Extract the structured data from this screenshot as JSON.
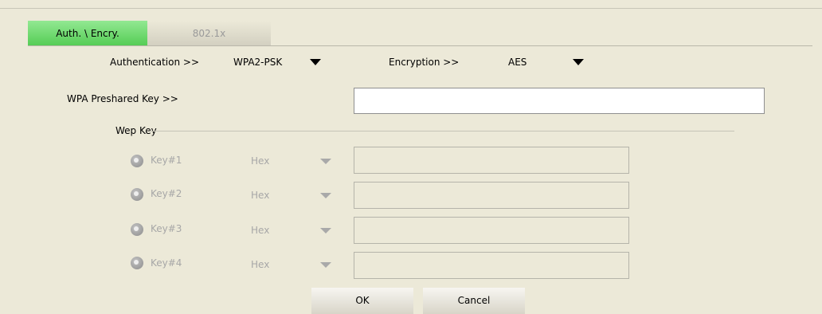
{
  "tabs": [
    {
      "label": "Auth. \\ Encry.",
      "active": true
    },
    {
      "label": "802.1x",
      "active": false
    }
  ],
  "authentication": {
    "label": "Authentication >>",
    "value": "WPA2-PSK"
  },
  "encryption": {
    "label": "Encryption >>",
    "value": "AES"
  },
  "wpa_preshared_key": {
    "label": "WPA Preshared Key >>",
    "value": ""
  },
  "wep_key": {
    "group_label": "Wep Key",
    "keys": [
      {
        "label": "Key#1",
        "format": "Hex",
        "value": ""
      },
      {
        "label": "Key#2",
        "format": "Hex",
        "value": ""
      },
      {
        "label": "Key#3",
        "format": "Hex",
        "value": ""
      },
      {
        "label": "Key#4",
        "format": "Hex",
        "value": ""
      }
    ]
  },
  "buttons": {
    "ok": "OK",
    "cancel": "Cancel"
  },
  "colors": {
    "background": "#ece9d8",
    "active_tab": "#6bd96b",
    "disabled_text": "#a7a7a7"
  }
}
